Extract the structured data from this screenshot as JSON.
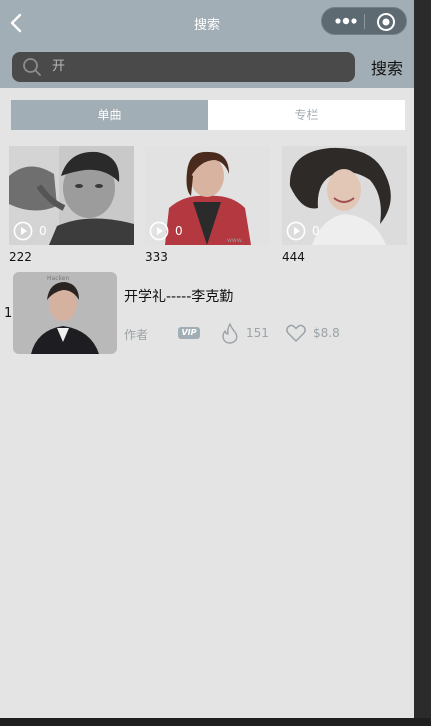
{
  "navbar": {
    "title": "搜索"
  },
  "search": {
    "value": "开",
    "button_label": "搜索"
  },
  "tabs": [
    {
      "label": "单曲",
      "active": true
    },
    {
      "label": "专栏",
      "active": false
    }
  ],
  "grid": [
    {
      "title": "222",
      "play_count": "0"
    },
    {
      "title": "333",
      "play_count": "0"
    },
    {
      "title": "444",
      "play_count": "0"
    }
  ],
  "list": [
    {
      "index": "1",
      "title": "开学礼-----李克勤",
      "author": "作者",
      "badge": "VIP",
      "hot_count": "151",
      "price": "$8.8"
    }
  ],
  "colors": {
    "accent": "#a2aeb5",
    "page_bg": "#e4e4e4",
    "meta_text": "#9aa3a8"
  }
}
